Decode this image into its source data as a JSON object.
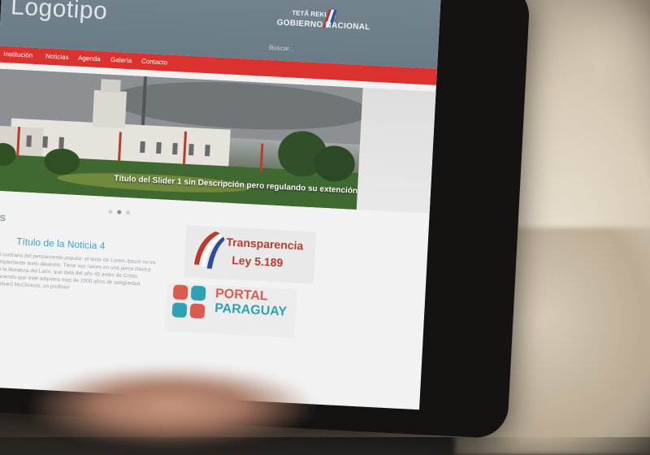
{
  "header": {
    "logo": "Logotipo",
    "gov_top": "TETÃ REKUÁI",
    "gov_name": "GOBIERNO NACIONAL",
    "search": "Buscar..."
  },
  "nav": {
    "items": [
      "Institución",
      "Noticias",
      "Agenda",
      "Galería",
      "Contacto"
    ]
  },
  "slider": {
    "caption": "Título del Slider 1 sin Descripción pero regulando su extención",
    "dots": 3,
    "active_dot": 2
  },
  "section": {
    "heading": "es"
  },
  "news": {
    "title": "Título de la Noticia 4",
    "text": "Al contrario del pensamiento popular, el texto de Lorem Ipsum no es simplemente texto aleatorio. Tiene sus raíces en una pieza clásica de la literatura del Latín, que data del año 45 antes de Cristo, haciendo que este adquiera mas de 2000 años de antigüedad. Richard McClintock, un profesor"
  },
  "banners": {
    "transparencia_l1": "Transparencia",
    "transparencia_l2": "Ley 5.189",
    "portal_l1": "PORTAL",
    "portal_l2": "PARAGUAY"
  },
  "colors": {
    "header": "#6a7c87",
    "nav": "#e3302d",
    "link": "#3aa3d8",
    "transparencia": "#c0392b"
  }
}
